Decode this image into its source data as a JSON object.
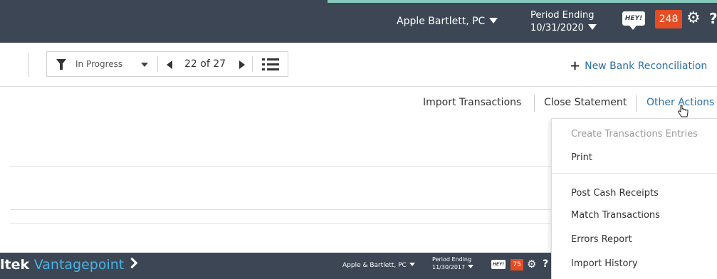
{
  "header": {
    "company": "Apple Bartlett, PC",
    "period_label": "Period Ending",
    "period_date": "10/31/2020",
    "hey_label": "HEY!",
    "notification_count": "248",
    "gear_glyph": "⚙",
    "help_glyph": "?"
  },
  "toolbar": {
    "filter_value": "In Progress",
    "pager_text": "22 of 27",
    "new_button_label": "New Bank Reconciliation"
  },
  "actions": {
    "import": "Import Transactions",
    "close": "Close Statement",
    "other": "Other Actions"
  },
  "menu": {
    "items": [
      {
        "label": "Create Transactions Entries",
        "disabled": true
      },
      {
        "label": "Print",
        "disabled": false
      },
      {
        "label": "Post Cash Receipts",
        "disabled": false
      },
      {
        "label": "Match Transactions",
        "disabled": false
      },
      {
        "label": "Errors Report",
        "disabled": false
      },
      {
        "label": "Import History",
        "disabled": false
      }
    ]
  },
  "overlay_bar": {
    "brand_prefix": "ltek",
    "brand_name": "Vantagepoint",
    "company": "Apple & Bartlett, PC",
    "period_label": "Period Ending",
    "period_date": "11/30/2017",
    "hey_label": "HEY!",
    "notification_count": "75",
    "gear_glyph": "⚙",
    "help_glyph": "?"
  },
  "colors": {
    "header_bg": "#3c4654",
    "accent_blue": "#2a6fae",
    "badge_orange": "#e64c24",
    "brand_blue": "#46b4e6"
  },
  "icons": [
    "funnel-icon",
    "prev-arrow-icon",
    "next-arrow-icon",
    "list-icon",
    "plus-icon",
    "gear-icon",
    "help-icon",
    "hand-cursor-icon",
    "chevron-right-icon"
  ]
}
